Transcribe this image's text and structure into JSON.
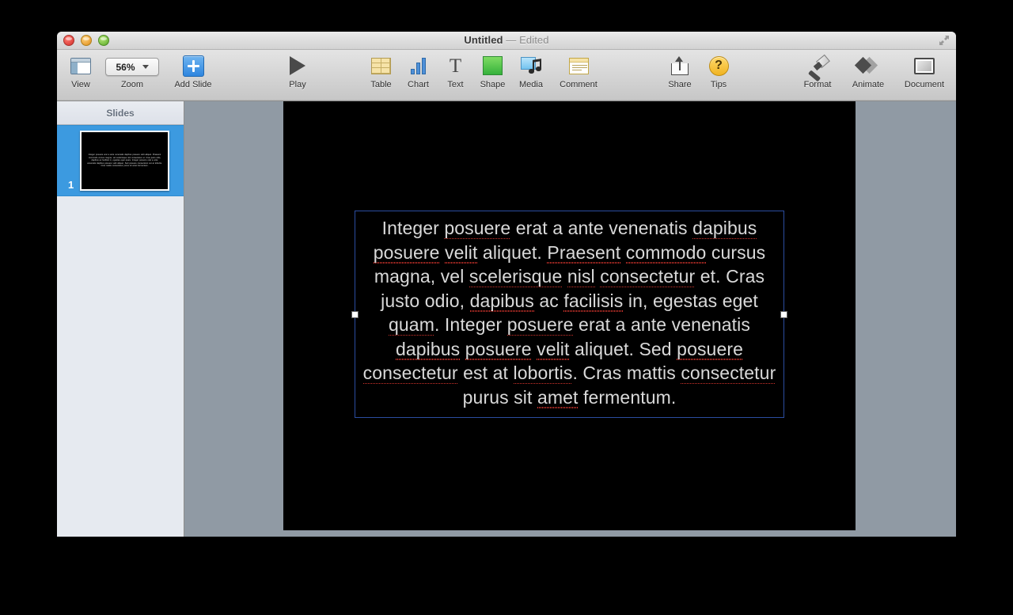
{
  "window": {
    "title": "Untitled",
    "title_separator": "—",
    "edited_state": "Edited",
    "traffic_lights": {
      "close": "close-button",
      "minimize": "minimize-button",
      "maximize": "maximize-button"
    },
    "fullscreen_icon": "fullscreen-expand-icon"
  },
  "toolbar": {
    "view": {
      "label": "View",
      "icon": "view-panel-icon"
    },
    "zoom": {
      "label": "Zoom",
      "value": "56%",
      "icon": "chevron-down-icon"
    },
    "add_slide": {
      "label": "Add Slide",
      "icon": "plus-icon"
    },
    "play": {
      "label": "Play",
      "icon": "play-triangle-icon"
    },
    "table": {
      "label": "Table",
      "icon": "table-grid-icon"
    },
    "chart": {
      "label": "Chart",
      "icon": "bar-chart-icon"
    },
    "text": {
      "label": "Text",
      "icon": "text-t-icon",
      "glyph": "T"
    },
    "shape": {
      "label": "Shape",
      "icon": "green-square-icon"
    },
    "media": {
      "label": "Media",
      "icon": "photo-music-note-icon"
    },
    "comment": {
      "label": "Comment",
      "icon": "comment-note-icon"
    },
    "share": {
      "label": "Share",
      "icon": "share-upload-icon"
    },
    "tips": {
      "label": "Tips",
      "icon": "question-mark-icon",
      "glyph": "?"
    },
    "format": {
      "label": "Format",
      "icon": "paintbrush-icon"
    },
    "animate": {
      "label": "Animate",
      "icon": "double-diamond-icon"
    },
    "document": {
      "label": "Document",
      "icon": "document-frame-icon"
    }
  },
  "sidebar": {
    "header": "Slides",
    "slides": [
      {
        "number": "1",
        "selected": true,
        "thumbnail_text": "Integer posuere erat a ante venenatis dapibus posuere velit aliquet. Praesent commodo cursus magna, vel scelerisque nisl consectetur et. Cras justo odio, dapibus ac facilisis in, egestas eget quam. Integer posuere erat a ante venenatis dapibus posuere velit aliquet. Sed posuere consectetur est at lobortis. Cras mattis consectetur purus sit amet fermentum."
      }
    ]
  },
  "canvas": {
    "slide_background": "#000000",
    "backdrop_color": "#909aa4",
    "textbox": {
      "selected": true,
      "selection_border_color": "#2b4da0",
      "text_color": "#d9d9d9",
      "full_text": "Integer posuere erat a ante venenatis dapibus posuere velit aliquet. Praesent commodo cursus magna, vel scelerisque nisl consectetur et. Cras justo odio, dapibus ac facilisis in, egestas eget quam. Integer posuere erat a ante venenatis dapibus posuere velit aliquet. Sed posuere consectetur est at lobortis. Cras mattis consectetur purus sit amet fermentum.",
      "misspelled_words": [
        "posuere",
        "dapibus",
        "velit",
        "Praesent",
        "commodo",
        "scelerisque",
        "nisl",
        "consectetur",
        "facilisis",
        "quam",
        "lobortis",
        "amet"
      ],
      "handles": [
        "middle-left",
        "middle-right"
      ]
    }
  },
  "colors": {
    "selection_blue": "#3c9ae0",
    "spellcheck_red": "#d0342c",
    "toolbar_top": "#e4e4e4",
    "toolbar_bottom": "#c6c6c6",
    "sidebar_background": "#e6eaf0"
  }
}
